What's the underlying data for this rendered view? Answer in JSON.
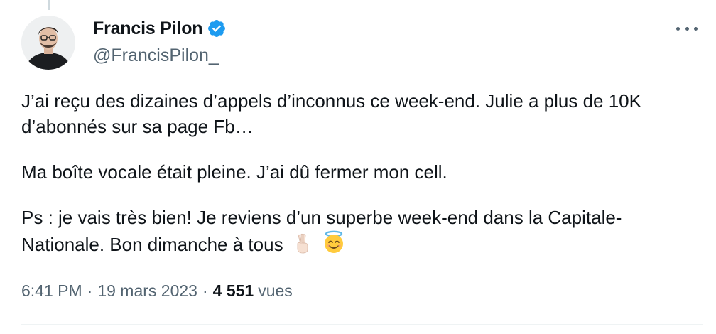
{
  "author": {
    "display_name": "Francis Pilon",
    "handle": "@FrancisPilon_",
    "verified": true
  },
  "tweet": {
    "paragraphs": [
      {
        "lines": [
          "J’ai reçu des dizaines d’appels d’inconnus ce week-end. Julie a plus de 10K",
          "d’abonnés sur sa page Fb…"
        ]
      },
      {
        "lines": [
          "Ma boîte vocale était pleine. J’ai dû fermer mon cell."
        ]
      },
      {
        "lines": [
          "Ps : je vais très bien! Je reviens d’un superbe week-end dans la Capitale-",
          "Nationale. Bon dimanche à tous"
        ]
      }
    ]
  },
  "meta": {
    "time": "6:41 PM",
    "separator": "·",
    "date": "19 mars 2023",
    "views_count": "4 551",
    "views_label": "vues"
  },
  "colors": {
    "verified_badge": "#1d9bf0",
    "secondary_text": "#536471",
    "primary_text": "#0f1419"
  },
  "icons": {
    "verified": "verified-badge-icon",
    "more": "more-options-icon",
    "emoji_1": "victory-hand-emoji",
    "emoji_2": "smiling-face-with-halo-emoji"
  }
}
